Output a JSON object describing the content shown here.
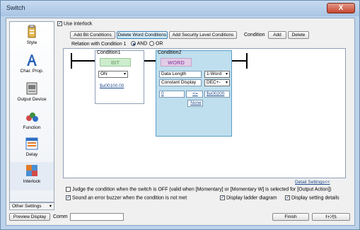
{
  "window": {
    "title": "Switch",
    "close_label": "X"
  },
  "sidebar": {
    "items": [
      {
        "label": "Style",
        "icon": "style-icon"
      },
      {
        "label": "Char. Prop.",
        "icon": "text-a-icon"
      },
      {
        "label": "Output Device",
        "icon": "device-icon"
      },
      {
        "label": "Function",
        "icon": "function-icon"
      },
      {
        "label": "Delay",
        "icon": "delay-icon"
      },
      {
        "label": "Interlock",
        "icon": "interlock-icon"
      }
    ],
    "other_settings": "Other Settings",
    "other_settings_arrow": "▾"
  },
  "interlock": {
    "use_label": "Use interlock",
    "checked": true
  },
  "toolbar": {
    "add_bit": "Add Bit Conditions",
    "delete_word": "Delete Word Conditions",
    "add_security": "Add Security Level Conditions",
    "condition_label": "Condition",
    "add": "Add",
    "delete": "Delete"
  },
  "relation": {
    "label": "Relation with Condition 1",
    "and": "AND",
    "or": "OR",
    "selected": "AND"
  },
  "condition1": {
    "title": "Condition1",
    "type": "BIT",
    "state": "ON",
    "device": "$u00100.00"
  },
  "condition2": {
    "title": "Condition2",
    "type": "WORD",
    "data_length_label": "Data Length",
    "data_length": "1-Word",
    "constant_display_label": "Constant Display",
    "constant_display": "DEC+-",
    "constant": "0",
    "operator": "<=",
    "device": "$u00200",
    "none": "None"
  },
  "detail_settings": "Detail Settings<<",
  "options": {
    "judge_off": "Judge the condition when the switch is OFF (valid when [Momentary] or [Momentary W] is selected for [Output Action])",
    "judge_off_checked": false,
    "error_buzzer": "Sound an error buzzer when the condition is not met",
    "error_buzzer_checked": true,
    "display_ladder": "Display ladder diagram",
    "display_ladder_checked": true,
    "display_setting": "Display setting details",
    "display_setting_checked": true
  },
  "footer": {
    "preview": "Preview Display",
    "comment_label": "Comm",
    "comment_value": "",
    "finish": "Finish",
    "cancel": "ｷｬﾝｾﾙ"
  },
  "caret": "▾"
}
